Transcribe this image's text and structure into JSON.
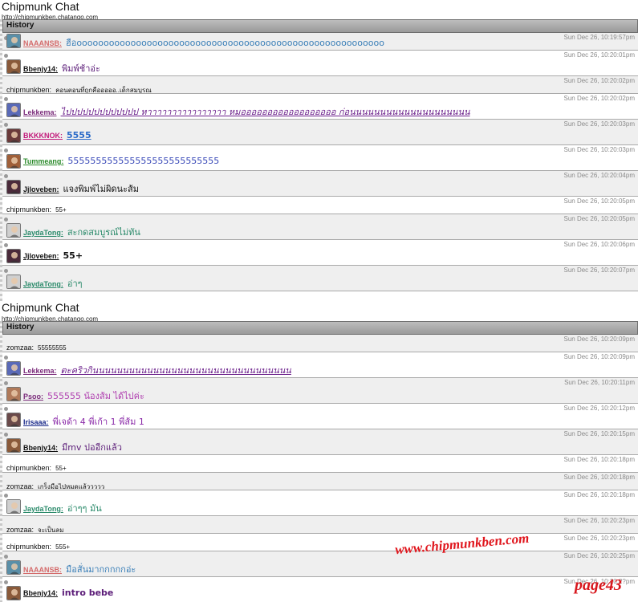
{
  "panels": [
    {
      "app_title": "Chipmunk Chat",
      "app_url": "http://chipmunkben.chatango.com",
      "history_label": "History",
      "messages": [
        {
          "user": "NAAANSB",
          "text": "ฮือooooooooooooooooooooooooooooooooooooooooooooooooooooooooo",
          "time": "Sun Dec 26, 10:19:57pm",
          "user_color": "#d46a6a",
          "text_color": "#3a7fb8",
          "avatar": "landscape-avatar-icon",
          "avatar_color": "#5a8fa8"
        },
        {
          "user": "Bbenjy14",
          "text": "พิมพ์ช้าอ่ะ",
          "time": "Sun Dec 26, 10:20:01pm",
          "user_color": "#111111",
          "text_color": "#5b1c78",
          "avatar": "person-avatar-icon",
          "avatar_color": "#8a5a3a"
        },
        {
          "user": "chipmunkben",
          "text": "คอนตอนที่ถูกคือออออ..เด็กสมบูรณ",
          "time": "Sun Dec 26, 10:20:02pm",
          "plain": true
        },
        {
          "user": "Lekkema",
          "text": "ไปปปปปปปปปปปปป หาาาาาาาาาาาาาาาา หมออออออออออออออออออ ก่อนนนนนนนนนนนนนนนนนนนน",
          "time": "Sun Dec 26, 10:20:02pm",
          "user_color": "#7a2a7a",
          "text_color": "#6a1e8a",
          "avatar": "blue-avatar-icon",
          "avatar_color": "#5a6ab8",
          "italic": true,
          "underline": true
        },
        {
          "user": "BKKKNOK",
          "text": "5555",
          "time": "Sun Dec 26, 10:20:03pm",
          "user_color": "#c2187a",
          "text_color": "#2a6ac8",
          "avatar": "dark-avatar-icon",
          "avatar_color": "#6a3a3a",
          "bold": true,
          "underline": true
        },
        {
          "user": "Tummeang",
          "text": "555555555555555555555555555",
          "time": "Sun Dec 26, 10:20:03pm",
          "user_color": "#2a8a2a",
          "text_color": "#3a4ab8",
          "avatar": "person-avatar-icon",
          "avatar_color": "#a0603a"
        },
        {
          "user": "Jjloveben",
          "text": "แจงพิมพ์ไม่ผิดนะส้ม",
          "time": "Sun Dec 26, 10:20:04pm",
          "user_color": "#111111",
          "text_color": "#111111",
          "avatar": "dark-avatar-icon",
          "avatar_color": "#4a2a3a"
        },
        {
          "user": "chipmunkben",
          "text": "55+",
          "time": "Sun Dec 26, 10:20:05pm",
          "plain": true
        },
        {
          "user": "JaydaTong",
          "text": "สะกดสมบูรณ์ไม่ทัน",
          "time": "Sun Dec 26, 10:20:05pm",
          "user_color": "#2a8a6a",
          "text_color": "#2a8a6a",
          "avatar": "panda-avatar-icon",
          "avatar_color": "#cfcfcf"
        },
        {
          "user": "Jjloveben",
          "text": "55+",
          "time": "Sun Dec 26, 10:20:06pm",
          "user_color": "#111111",
          "text_color": "#111111",
          "avatar": "dark-avatar-icon",
          "avatar_color": "#4a2a3a",
          "bold": true
        },
        {
          "user": "JaydaTong",
          "text": "อ่าๆ",
          "time": "Sun Dec 26, 10:20:07pm",
          "user_color": "#2a8a6a",
          "text_color": "#2a8a6a",
          "avatar": "panda-avatar-icon",
          "avatar_color": "#cfcfcf"
        }
      ]
    },
    {
      "app_title": "Chipmunk Chat",
      "app_url": "http://chipmunkben.chatango.com",
      "history_label": "History",
      "messages": [
        {
          "user": "zomzaa",
          "text": "55555555",
          "time": "Sun Dec 26, 10:20:09pm",
          "plain": true
        },
        {
          "user": "Lekkema",
          "text": "ตะคริวกินนนนนนนนนนนนนนนนนนนนนนนนนนนนนนนนน",
          "time": "Sun Dec 26, 10:20:09pm",
          "user_color": "#7a2a7a",
          "text_color": "#6a1e8a",
          "avatar": "blue-avatar-icon",
          "avatar_color": "#5a6ab8",
          "italic": true,
          "underline": true
        },
        {
          "user": "Psoo",
          "text": "555555 น้องส้ม ได้ไปค่ะ",
          "time": "Sun Dec 26, 10:20:11pm",
          "user_color": "#7a2a7a",
          "text_color": "#b040b0",
          "avatar": "person-avatar-icon",
          "avatar_color": "#b07a5a"
        },
        {
          "user": "Irisaaa",
          "text": "พี่เจด้า 4 พี่เก้า 1 พี่ส้ม 1",
          "time": "Sun Dec 26, 10:20:12pm",
          "user_color": "#1a2a8a",
          "text_color": "#8a2aa8",
          "avatar": "person-avatar-icon",
          "avatar_color": "#6a4a4a"
        },
        {
          "user": "Bbenjy14",
          "text": "มีmv ปออีกแล้ว",
          "time": "Sun Dec 26, 10:20:15pm",
          "user_color": "#111111",
          "text_color": "#5b1c78",
          "avatar": "person-avatar-icon",
          "avatar_color": "#8a5a3a"
        },
        {
          "user": "chipmunkben",
          "text": "55+",
          "time": "Sun Dec 26, 10:20:18pm",
          "plain": true
        },
        {
          "user": "zomzaa",
          "text": "เกร็งมือไปหมดแล้ววววว",
          "time": "Sun Dec 26, 10:20:18pm",
          "plain": true
        },
        {
          "user": "JaydaTong",
          "text": "อ่าๆๆ มัน",
          "time": "Sun Dec 26, 10:20:18pm",
          "user_color": "#2a8a6a",
          "text_color": "#2a8a6a",
          "avatar": "panda-avatar-icon",
          "avatar_color": "#cfcfcf"
        },
        {
          "user": "zomzaa",
          "text": "จะเป็นลม",
          "time": "Sun Dec 26, 10:20:23pm",
          "plain": true
        },
        {
          "user": "chipmunkben",
          "text": "555+",
          "time": "Sun Dec 26, 10:20:23pm",
          "plain": true
        },
        {
          "user": "NAAANSB",
          "text": "มือสั่นมากกกกกอ่ะ",
          "time": "Sun Dec 26, 10:20:25pm",
          "user_color": "#d46a6a",
          "text_color": "#3a7fb8",
          "avatar": "landscape-avatar-icon",
          "avatar_color": "#5a8fa8"
        },
        {
          "user": "Bbenjy14",
          "text": "intro bebe",
          "time": "Sun Dec 26, 10:20:2?pm",
          "user_color": "#111111",
          "text_color": "#5b1c78",
          "avatar": "person-avatar-icon",
          "avatar_color": "#8a5a3a",
          "bold": true
        }
      ]
    }
  ],
  "watermark": "www.chipmunkben.com",
  "page_mark": "page43",
  "colors": {
    "history_bar": "#a8a8a8",
    "row_alt": "#efefef",
    "watermark": "#e0151c"
  }
}
